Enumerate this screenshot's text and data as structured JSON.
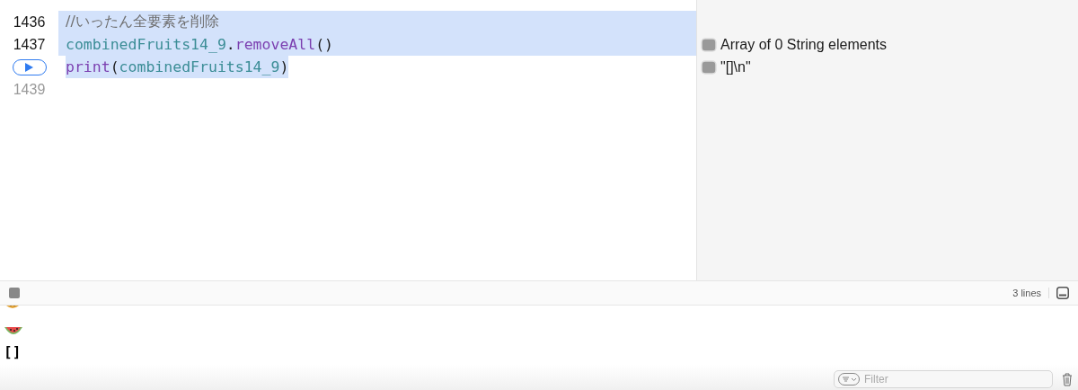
{
  "editor": {
    "lines": [
      {
        "kind": "number",
        "number": "1436",
        "executed": true,
        "selected": true,
        "full_line": true,
        "tokens": [
          {
            "kind": "comment",
            "text": "//いったん全要素を削除"
          }
        ]
      },
      {
        "kind": "number",
        "number": "1437",
        "executed": true,
        "selected": true,
        "full_line": true,
        "tokens": [
          {
            "kind": "ident",
            "text": "combinedFruits14_9"
          },
          {
            "kind": "plain",
            "text": "."
          },
          {
            "kind": "method",
            "text": "removeAll"
          },
          {
            "kind": "plain",
            "text": "()"
          }
        ],
        "result": "Array of 0 String elements"
      },
      {
        "kind": "run",
        "executed": true,
        "selected": true,
        "full_line": false,
        "tokens": [
          {
            "kind": "method",
            "text": "print"
          },
          {
            "kind": "plain",
            "text": "("
          },
          {
            "kind": "ident",
            "text": "combinedFruits14_9"
          },
          {
            "kind": "plain",
            "text": ")"
          }
        ],
        "result": "\"[]\\n\""
      },
      {
        "kind": "number",
        "number": "1439",
        "executed": false,
        "selected": false
      }
    ]
  },
  "console_bar": {
    "line_count": "3 lines"
  },
  "console": {
    "lines": [
      {
        "kind": "fruit-cut"
      },
      {
        "kind": "watermelon"
      },
      {
        "kind": "text",
        "text": "[]"
      }
    ]
  },
  "filter": {
    "placeholder": "Filter"
  }
}
